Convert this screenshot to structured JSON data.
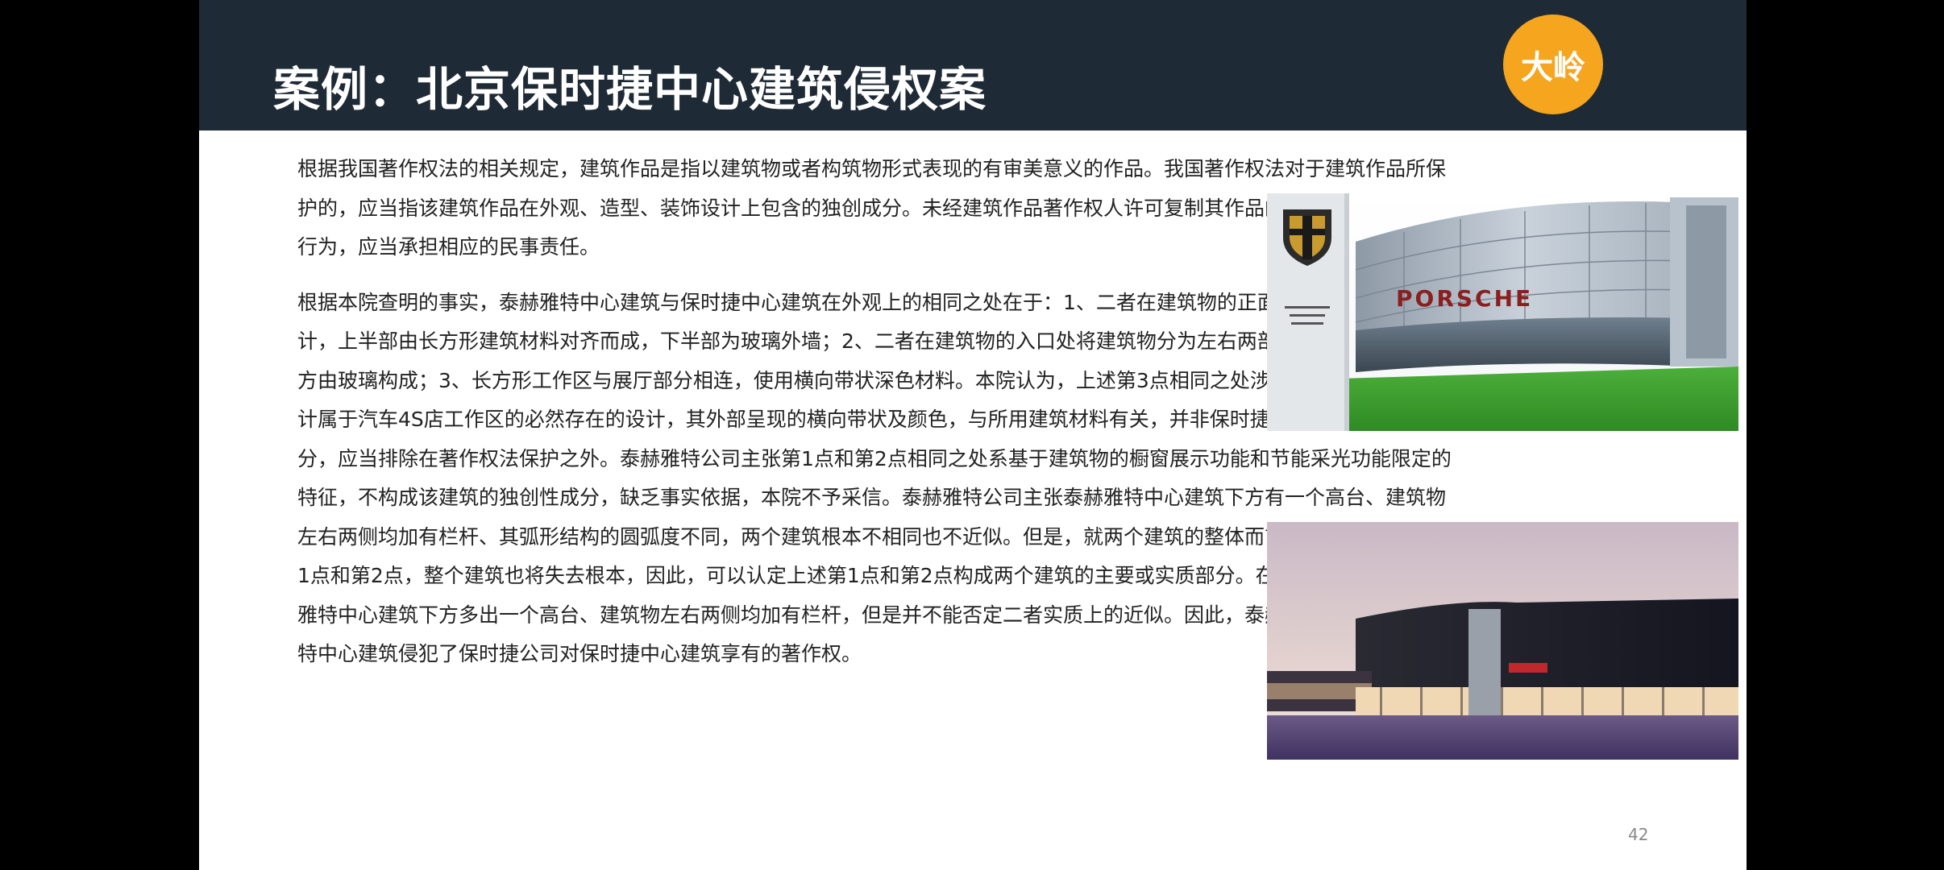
{
  "slide": {
    "title": "案例：北京保时捷中心建筑侵权案",
    "logo_text": "大岭",
    "paragraphs": [
      "根据我国著作权法的相关规定，建筑作品是指以建筑物或者构筑物形式表现的有审美意义的作品。我国著作权法对于建筑作品所保护的，应当指该建筑作品在外观、造型、装饰设计上包含的独创成分。未经建筑作品著作权人许可复制其作品的，是侵犯著作权的行为，应当承担相应的民事责任。",
      "根据本院查明的事实，泰赫雅特中心建筑与保时捷中心建筑在外观上的相同之处在于：1、二者在建筑物的正面均采用圆弧形设计，上半部由长方形建筑材料对齐而成，下半部为玻璃外墙；2、二者在建筑物的入口处将建筑物分为左右两部分，入口部分及上方由玻璃构成；3、长方形工作区与展厅部分相连，使用横向带状深色材料。本院认为，上述第3点相同之处涉及的工作区部分的设计属于汽车4S店工作区的必然存在的设计，其外部呈现的横向带状及颜色，与所用建筑材料有关，并非保时捷中心建筑的独创性成分，应当排除在著作权法保护之外。泰赫雅特公司主张第1点和第2点相同之处系基于建筑物的橱窗展示功能和节能采光功能限定的特征，不构成该建筑的独创性成分，缺乏事实依据，本院不予采信。泰赫雅特公司主张泰赫雅特中心建筑下方有一个高台、建筑物左右两侧均加有栏杆、其弧形结构的圆弧度不同，两个建筑根本不相同也不近似。但是，就两个建筑的整体而言，如果舍去上述第1点和第2点，整个建筑也将失去根本，因此，可以认定上述第1点和第2点构成两个建筑的主要或实质部分。在此前提下，虽然泰赫雅特中心建筑下方多出一个高台、建筑物左右两侧均加有栏杆，但是并不能否定二者实质上的近似。因此，泰赫雅特公司的泰赫雅特中心建筑侵犯了保时捷公司对保时捷中心建筑享有的著作权。"
    ],
    "photo_1": {
      "sign_text": "PORSCHE"
    },
    "page_number": "42"
  },
  "colors": {
    "header_bg": "#1e2a35",
    "logo_bg": "#f5a51e",
    "body_text": "#222222"
  }
}
